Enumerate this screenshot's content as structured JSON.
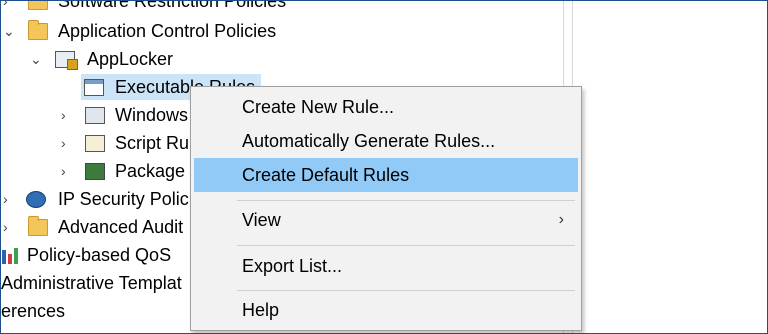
{
  "tree": {
    "items": [
      {
        "label": "Software Restriction Policies"
      },
      {
        "label": "Application Control Policies"
      },
      {
        "label": "AppLocker"
      },
      {
        "label": "Executable Rules"
      },
      {
        "label": "Windows"
      },
      {
        "label": "Script Ru"
      },
      {
        "label": "Package"
      },
      {
        "label": "IP Security Polic"
      },
      {
        "label": "Advanced Audit"
      },
      {
        "label": "Policy-based QoS"
      },
      {
        "label": "Administrative Templat"
      },
      {
        "label": "erences"
      }
    ]
  },
  "context_menu": {
    "items": [
      {
        "label": "Create New Rule..."
      },
      {
        "label": "Automatically Generate Rules..."
      },
      {
        "label": "Create Default Rules"
      },
      {
        "label": "View",
        "submenu_arrow": "›"
      },
      {
        "label": "Export List..."
      },
      {
        "label": "Help"
      }
    ],
    "highlight_color": "#91c9f7"
  }
}
